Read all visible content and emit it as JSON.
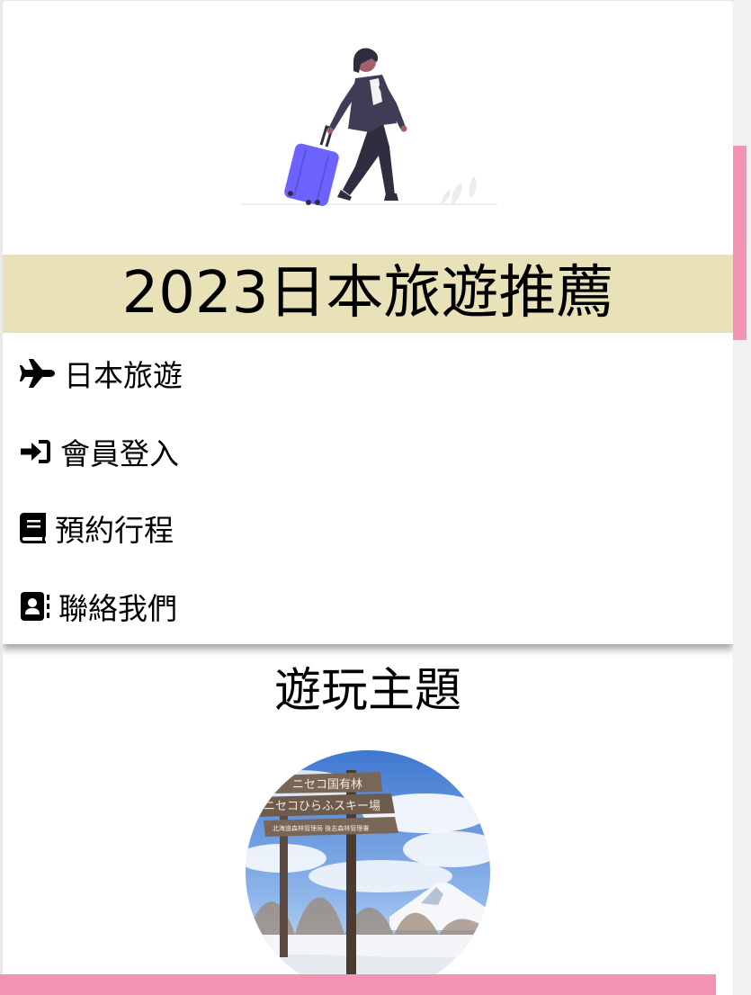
{
  "banner": {
    "illustration": "traveler-with-suitcase",
    "title": "2023日本旅遊推薦",
    "band_color": "#e9e2b9"
  },
  "nav": {
    "items": [
      {
        "icon": "plane-icon",
        "label": "日本旅遊"
      },
      {
        "icon": "sign-in-icon",
        "label": "會員登入"
      },
      {
        "icon": "book-icon",
        "label": "預約行程"
      },
      {
        "icon": "address-book-icon",
        "label": "聯絡我們"
      }
    ]
  },
  "section": {
    "title": "遊玩主題",
    "photo_signs": [
      "ニセコ国有林",
      "ニセコひらふスキー場",
      "北海道森林管理局 後志森林管理署"
    ]
  },
  "colors": {
    "accent_pink": "#f394b4",
    "suitcase": "#6c63ff"
  }
}
